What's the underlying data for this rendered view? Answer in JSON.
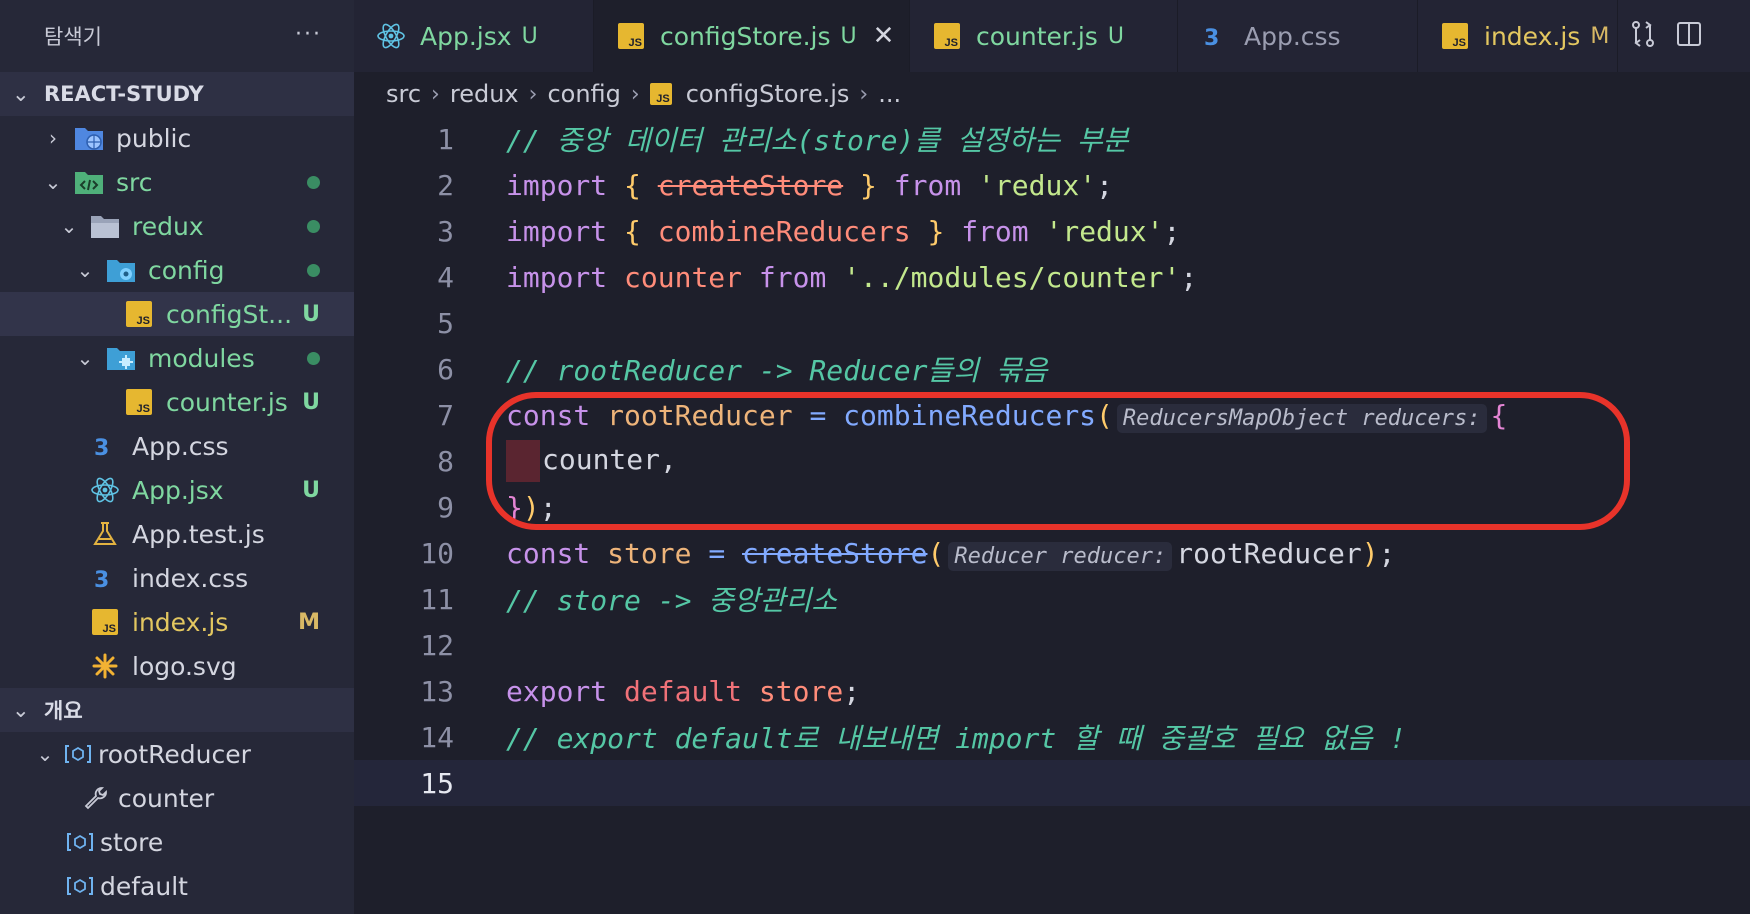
{
  "sidebar": {
    "explorer_title": "탐색기",
    "more": "···",
    "project_name": "REACT-STUDY",
    "tree": [
      {
        "label": "public",
        "chevron": "›",
        "icon": "folder-public-icon"
      },
      {
        "label": "src",
        "chevron": "⌄",
        "icon": "folder-src-icon"
      },
      {
        "label": "redux",
        "chevron": "⌄",
        "icon": "folder-icon"
      },
      {
        "label": "config",
        "chevron": "⌄",
        "icon": "folder-config-icon"
      },
      {
        "label": "configSt...",
        "badge": "U",
        "icon": "js-file-icon"
      },
      {
        "label": "modules",
        "chevron": "⌄",
        "icon": "folder-modules-icon"
      },
      {
        "label": "counter.js",
        "badge": "U",
        "icon": "js-file-icon"
      },
      {
        "label": "App.css",
        "icon": "css-file-icon"
      },
      {
        "label": "App.jsx",
        "badge": "U",
        "icon": "react-file-icon"
      },
      {
        "label": "App.test.js",
        "icon": "test-file-icon"
      },
      {
        "label": "index.css",
        "icon": "css-file-icon"
      },
      {
        "label": "index.js",
        "badge": "M",
        "icon": "js-file-icon"
      },
      {
        "label": "logo.svg",
        "icon": "svg-file-icon"
      }
    ],
    "outline_title": "개요",
    "outline": [
      {
        "label": "rootReducer",
        "chevron": "⌄",
        "icon": "variable-icon"
      },
      {
        "label": "counter",
        "icon": "property-icon"
      },
      {
        "label": "store",
        "icon": "variable-icon"
      },
      {
        "label": "default",
        "icon": "variable-icon"
      }
    ]
  },
  "tabs": [
    {
      "label": "App.jsx",
      "badge": "U",
      "icon": "react-file-icon"
    },
    {
      "label": "configStore.js",
      "badge": "U",
      "icon": "js-file-icon",
      "close": "✕"
    },
    {
      "label": "counter.js",
      "badge": "U",
      "icon": "js-file-icon"
    },
    {
      "label": "App.css",
      "icon": "css-file-icon"
    },
    {
      "label": "index.js",
      "badge": "M",
      "icon": "js-file-icon"
    }
  ],
  "breadcrumb": {
    "parts": [
      "src",
      "redux",
      "config",
      "configStore.js",
      "..."
    ],
    "sep": "›"
  },
  "editor": {
    "line_numbers": [
      "1",
      "2",
      "3",
      "4",
      "5",
      "6",
      "7",
      "8",
      "9",
      "10",
      "11",
      "12",
      "13",
      "14",
      "15"
    ],
    "l1": "// 중앙 데이터 관리소(store)를 설정하는 부분",
    "l2": {
      "import": "import",
      "ob": "{",
      "name": "createStore",
      "cb": "}",
      "from": "from",
      "str": "'redux'",
      "semi": ";"
    },
    "l3": {
      "import": "import",
      "ob": "{",
      "name": "combineReducers",
      "cb": "}",
      "from": "from",
      "str": "'redux'",
      "semi": ";"
    },
    "l4": {
      "import": "import",
      "name": "counter",
      "from": "from",
      "str": "'../modules/counter'",
      "semi": ";"
    },
    "l6": "// rootReducer -> Reducer들의 묶음",
    "l7": {
      "const": "const",
      "name": "rootReducer",
      "eq": "=",
      "fn": "combineReducers",
      "op": "(",
      "hint": "ReducersMapObject reducers:",
      "ob": "{"
    },
    "l8": "counter,",
    "l9": {
      "cb": "}",
      "cp": ")",
      "semi": ";"
    },
    "l10": {
      "const": "const",
      "name": "store",
      "eq": "=",
      "fn": "createStore",
      "op": "(",
      "hint": "Reducer reducer:",
      "arg": "rootReducer",
      "cp": ")",
      "semi": ";"
    },
    "l11": "// store -> 중앙관리소",
    "l13": {
      "export": "export",
      "default": "default",
      "name": "store",
      "semi": ";"
    },
    "l14": "// export default로 내보내면 import 할 때 중괄호 필요 없음 !"
  },
  "colors": {
    "accent_red": "#e8332a",
    "git_untracked": "#7fd7a0",
    "git_modified": "#d8b865"
  }
}
